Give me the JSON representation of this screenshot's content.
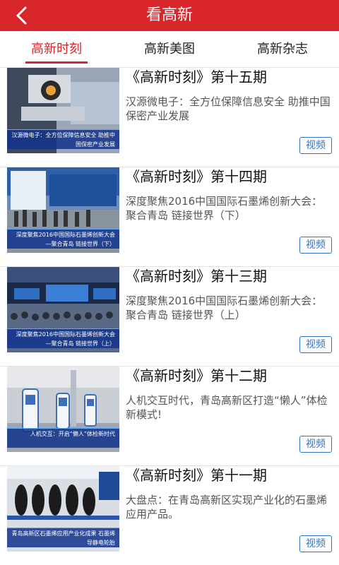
{
  "header": {
    "title": "看高新",
    "back_icon": "chevron-left-icon"
  },
  "tabs": [
    {
      "label": "高新时刻",
      "active": true
    },
    {
      "label": "高新美图",
      "active": false
    },
    {
      "label": "高新杂志",
      "active": false
    }
  ],
  "colors": {
    "brand_red": "#d8262b",
    "badge_blue": "#2f74c4"
  },
  "items": [
    {
      "title": "《高新时刻》第十五期",
      "description": "汉源微电子：全方位保障信息安全 助推中国保密产业发展",
      "badge": "视频",
      "thumb_caption": "汉源微电子：全方位保障信息安全 助推中国保密产业发展"
    },
    {
      "title": "《高新时刻》第十四期",
      "description": "深度聚焦2016中国国际石墨烯创新大会：聚合青岛 链接世界（下）",
      "badge": "视频",
      "thumb_caption": "深度聚焦2016中国国际石墨烯创新大会 —聚合青岛 链接世界（下）"
    },
    {
      "title": "《高新时刻》第十三期",
      "description": "深度聚焦2016中国国际石墨烯创新大会：聚合青岛 链接世界（上）",
      "badge": "视频",
      "thumb_caption": "深度聚焦2016中国国际石墨烯创新大会 —聚合青岛 链接世界（上）"
    },
    {
      "title": "《高新时刻》第十二期",
      "description": "人机交互时代，青岛高新区打造“懒人”体检新模式!",
      "badge": "视频",
      "thumb_caption": "人机交互：开启“懒人”体检新时代"
    },
    {
      "title": "《高新时刻》第十一期",
      "description": "大盘点：在青岛高新区实现产业化的石墨烯应用产品。",
      "badge": "视频",
      "thumb_caption": "青岛高新区石墨烯应用产业化成果 石墨烯导静电轮胎"
    }
  ]
}
